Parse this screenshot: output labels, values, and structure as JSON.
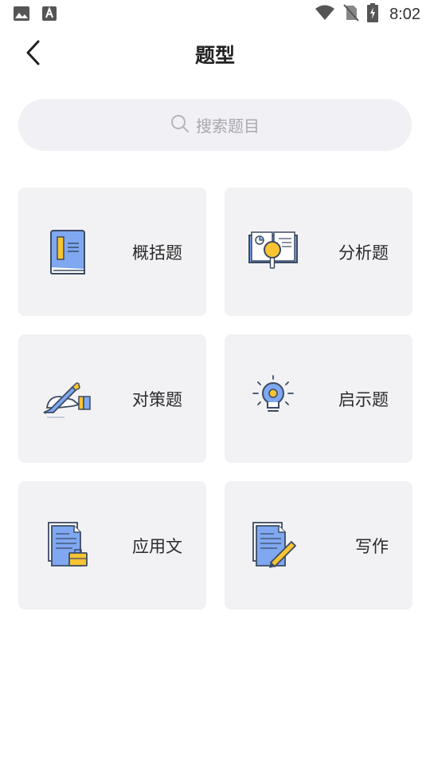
{
  "status_bar": {
    "time": "8:02",
    "icons": [
      "image-icon",
      "font-download-icon",
      "wifi-icon",
      "no-sim-icon",
      "battery-charging-icon"
    ]
  },
  "header": {
    "title": "题型",
    "back_icon": "chevron-left-icon"
  },
  "search": {
    "placeholder": "搜索题目",
    "icon": "search-icon"
  },
  "categories": [
    {
      "label": "概括题",
      "icon": "book-icon"
    },
    {
      "label": "分析题",
      "icon": "magnifier-book-icon"
    },
    {
      "label": "对策题",
      "icon": "pen-hand-icon"
    },
    {
      "label": "启示题",
      "icon": "lightbulb-icon"
    },
    {
      "label": "应用文",
      "icon": "document-briefcase-icon"
    },
    {
      "label": "写作",
      "icon": "document-pencil-icon"
    }
  ],
  "colors": {
    "accent_blue": "#7fa8f0",
    "accent_yellow": "#f8c433",
    "outline": "#3c4b63",
    "card_bg": "#f2f2f5"
  }
}
